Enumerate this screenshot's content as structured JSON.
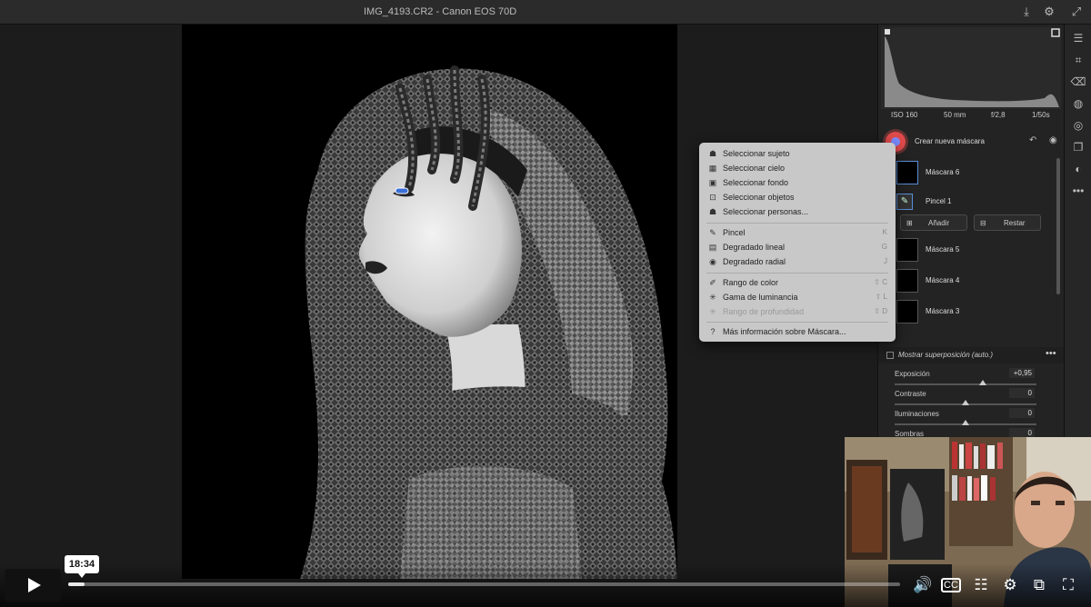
{
  "window": {
    "title": "IMG_4193.CR2 -  Canon EOS 70D"
  },
  "exif": {
    "iso": "ISO 160",
    "focal": "50 mm",
    "aperture": "f/2,8",
    "shutter": "1/50s"
  },
  "masks": {
    "create_label": "Crear nueva máscara",
    "items": [
      {
        "label": "Máscara 6"
      },
      {
        "label": "Máscara 5"
      },
      {
        "label": "Máscara 4"
      },
      {
        "label": "Máscara 3"
      }
    ],
    "brush_label": "Pincel 1",
    "add_label": "Añadir",
    "subtract_label": "Restar"
  },
  "overlay": {
    "label": "Mostrar superposición (auto.)"
  },
  "adjustments": [
    {
      "label": "Exposición",
      "value": "+0,95",
      "position": 0.62
    },
    {
      "label": "Contraste",
      "value": "0",
      "position": 0.5
    },
    {
      "label": "Iluminaciones",
      "value": "0",
      "position": 0.5
    },
    {
      "label": "Sombras",
      "value": "0",
      "position": 0.5
    }
  ],
  "menu": {
    "items": [
      {
        "label": "Seleccionar sujeto",
        "key": "",
        "icon": "person-icon"
      },
      {
        "label": "Seleccionar cielo",
        "key": "",
        "icon": "sky-icon"
      },
      {
        "label": "Seleccionar fondo",
        "key": "",
        "icon": "background-icon"
      },
      {
        "label": "Seleccionar objetos",
        "key": "",
        "icon": "objects-icon"
      },
      {
        "label": "Seleccionar personas...",
        "key": "",
        "icon": "people-icon"
      },
      {
        "label": "Pincel",
        "key": "K",
        "icon": "brush-icon"
      },
      {
        "label": "Degradado lineal",
        "key": "G",
        "icon": "linear-gradient-icon"
      },
      {
        "label": "Degradado radial",
        "key": "J",
        "icon": "radial-gradient-icon"
      },
      {
        "label": "Rango de color",
        "key": "⇧ C",
        "icon": "color-range-icon"
      },
      {
        "label": "Gama de luminancia",
        "key": "⇧ L",
        "icon": "luminance-range-icon"
      },
      {
        "label": "Rango de profundidad",
        "key": "⇧ D",
        "icon": "depth-range-icon"
      },
      {
        "label": "Más información sobre Máscara...",
        "key": "",
        "icon": "help-icon"
      }
    ]
  },
  "player": {
    "time": "18:34",
    "progress": 0.02
  },
  "colors": {
    "accent": "#5a8fd8",
    "mask_button": "#e04a4a"
  }
}
